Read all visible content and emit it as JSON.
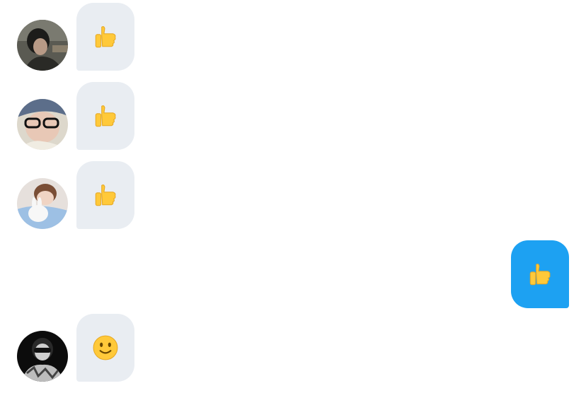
{
  "colors": {
    "incoming_bubble": "#e9edf2",
    "outgoing_bubble": "#1da1f2",
    "emoji_yellow": "#ffc93a",
    "emoji_shade": "#e6a823"
  },
  "messages": [
    {
      "direction": "incoming",
      "avatar": "user-avatar-1",
      "emoji": "thumbs-up-emoji"
    },
    {
      "direction": "incoming",
      "avatar": "user-avatar-2",
      "emoji": "thumbs-up-emoji"
    },
    {
      "direction": "incoming",
      "avatar": "user-avatar-3",
      "emoji": "thumbs-up-emoji"
    },
    {
      "direction": "outgoing",
      "avatar": null,
      "emoji": "thumbs-up-emoji"
    },
    {
      "direction": "incoming",
      "avatar": "user-avatar-4",
      "emoji": "slightly-smiling-face-emoji"
    }
  ]
}
